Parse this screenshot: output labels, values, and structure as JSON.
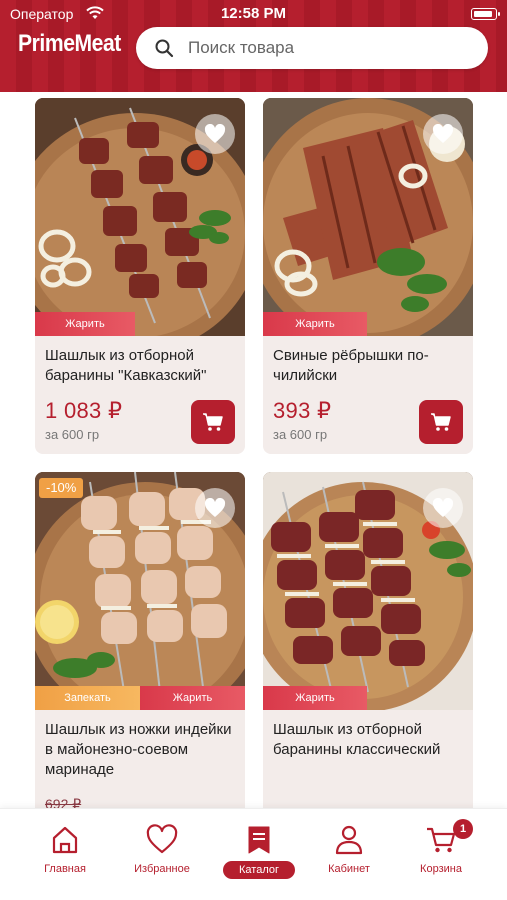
{
  "status_bar": {
    "carrier": "Оператор",
    "time": "12:58 PM"
  },
  "header": {
    "logo": "PrimeMeat"
  },
  "search": {
    "placeholder": "Поиск товара"
  },
  "products": [
    {
      "title": "Шашлык из отборной баранины \"Кавказский\"",
      "price": "1 083 ₽",
      "weight": "за 600 гр",
      "tags": [
        "Жарить"
      ]
    },
    {
      "title": "Свиные рёбрышки по-чилийски",
      "price": "393 ₽",
      "weight": "за 600 гр",
      "tags": [
        "Жарить"
      ]
    },
    {
      "title": "Шашлык из ножки индейки в майонезно-соевом маринаде",
      "discount": "-10%",
      "old_price": "692 ₽",
      "tags": [
        "Запекать",
        "Жарить"
      ]
    },
    {
      "title": "Шашлык из отборной баранины классический",
      "tags": [
        "Жарить"
      ]
    }
  ],
  "tabbar": {
    "items": [
      {
        "label": "Главная",
        "icon": "home-icon",
        "active": false
      },
      {
        "label": "Избранное",
        "icon": "heart-icon",
        "active": false
      },
      {
        "label": "Каталог",
        "icon": "catalog-icon",
        "active": true
      },
      {
        "label": "Кабинет",
        "icon": "profile-icon",
        "active": false
      },
      {
        "label": "Корзина",
        "icon": "cart-icon",
        "active": false,
        "badge": "1"
      }
    ]
  },
  "colors": {
    "brand": "#b51f2e",
    "tag_red": "#d9394a",
    "tag_orange": "#f0a045",
    "card_bg": "#f3ecea"
  }
}
